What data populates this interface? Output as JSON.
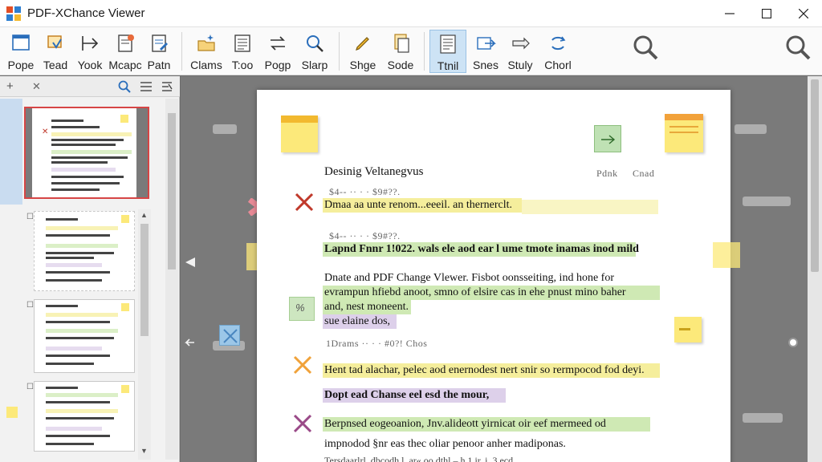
{
  "window": {
    "title": "PDF-XChance Viewer",
    "minimize": "—",
    "maximize": "☐",
    "close": "✕"
  },
  "ribbon": {
    "tools": [
      {
        "label": "Pope",
        "icon": "page-icon"
      },
      {
        "label": "Tead",
        "icon": "hand-tool-icon"
      },
      {
        "label": "Yook",
        "icon": "arrow-right-icon"
      },
      {
        "label": "Mcapc",
        "icon": "document-stamp-icon"
      },
      {
        "label": "Patn",
        "icon": "document-edit-icon"
      },
      {
        "label": "Clams",
        "icon": "folder-sparkle-icon"
      },
      {
        "label": "T:oo",
        "icon": "text-lines-icon"
      },
      {
        "label": "Pogp",
        "icon": "arrows-swap-icon"
      },
      {
        "label": "Slarp",
        "icon": "magnifier-icon"
      },
      {
        "label": "Shge",
        "icon": "pencil-icon"
      },
      {
        "label": "Sode",
        "icon": "document-copy-icon"
      },
      {
        "label": "Ttnil",
        "icon": "thumbnail-icon"
      },
      {
        "label": "Snes",
        "icon": "share-arrow-icon"
      },
      {
        "label": "Stuly",
        "icon": "pointer-icon"
      },
      {
        "label": "Chorl",
        "icon": "refresh-icon"
      }
    ],
    "active_tool": "Ttnil"
  },
  "left_panel": {
    "toolbar": {
      "add": "+",
      "close": "✕"
    },
    "expand_marker": "▼",
    "pages": [
      {
        "selected": true
      },
      {
        "selected": false
      },
      {
        "selected": false
      },
      {
        "selected": false
      }
    ]
  },
  "document": {
    "heading": "Desinig Veltanegvus",
    "heading_meta": [
      "Pdnk",
      "Cnad"
    ],
    "meta_lines": [
      "$4-- ·· · · $9#??.",
      "$4-- ·· · · $9#??."
    ],
    "lines": [
      {
        "text": "Dmaa aa unte renom...eeeil. an thernerclt.",
        "highlight": "yellow"
      },
      {
        "text": "Lapnd Fnnr 1!022. wals ele aod ear l ume tmote inamas inod mild",
        "highlight": "green"
      },
      {
        "text": "Dnate and PDF Change Vlewer. Fisbot oonsseiting, ind hone for",
        "highlight": ""
      },
      {
        "text": "evrampun hfiebd anoot, smno of elsire cas in ehe pnust mino baher",
        "highlight": "green"
      },
      {
        "text": "and, nest moneent.",
        "highlight": "green"
      },
      {
        "text": "sue elaine dos,",
        "highlight": "purple"
      },
      {
        "text": "1Drams ·· · · #0?! Chos",
        "highlight": ""
      },
      {
        "text": "Hent tad alachar, pelec aod enernodest nert snir so rermpocod fod deyi.",
        "highlight": "yellow"
      },
      {
        "text": "Dopt ead Chanse eel esd the mour,",
        "highlight": "purple"
      },
      {
        "text": "Berpnsed eogeoanion, Jnv.alideott yirnicat oir eef mermeed od",
        "highlight": "green"
      },
      {
        "text": "impnodod §nr eas thec oliar penoor anher madiponas.",
        "highlight": ""
      },
      {
        "text": "Tersdaarlrl. dbcodh l. ar« oo dthl – h 1 ir. i, 3 ecd",
        "highlight": ""
      }
    ],
    "margin_note": "%"
  },
  "colors": {
    "highlight_yellow": "#f5ee9c",
    "highlight_green": "#cfe9b4",
    "highlight_purple": "#ddd0ea",
    "selection_border": "#d64545",
    "note_yellow": "#fce97a"
  }
}
